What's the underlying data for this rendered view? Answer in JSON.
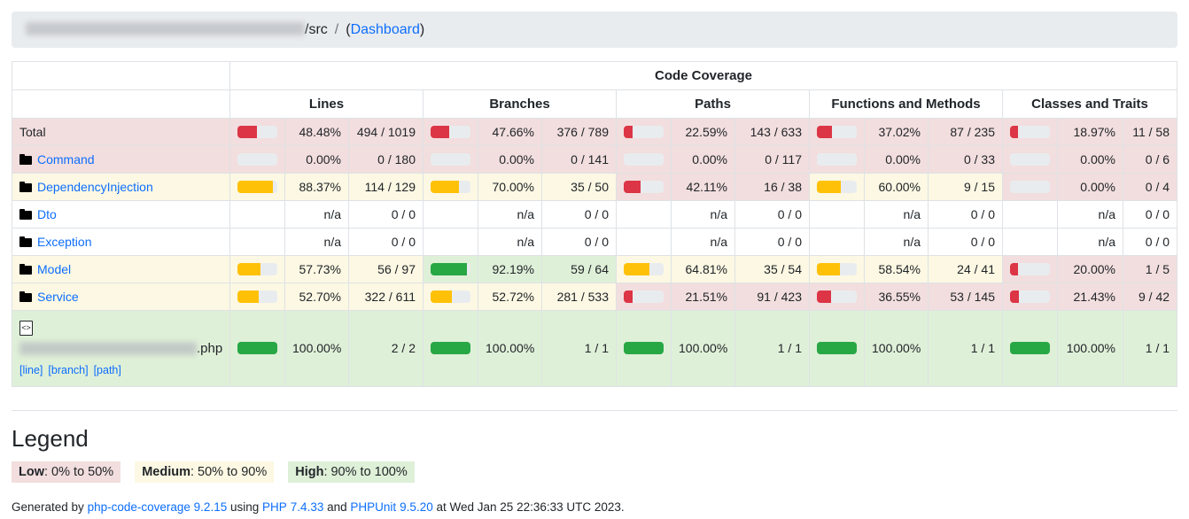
{
  "breadcrumb": {
    "redacted_path": "",
    "src_label": "/src",
    "separator": "/",
    "open_paren": "(",
    "dashboard_label": "Dashboard",
    "close_paren": ")"
  },
  "table": {
    "group_header": "Code Coverage",
    "metric_groups": [
      "Lines",
      "Branches",
      "Paths",
      "Functions and Methods",
      "Classes and Traits"
    ],
    "na_label": "n/a",
    "rows": [
      {
        "name": "Total",
        "kind": "total",
        "metrics": [
          {
            "percent": "48.48%",
            "fraction": "494 / 1019",
            "value": 48.48,
            "level": "low"
          },
          {
            "percent": "47.66%",
            "fraction": "376 / 789",
            "value": 47.66,
            "level": "low"
          },
          {
            "percent": "22.59%",
            "fraction": "143 / 633",
            "value": 22.59,
            "level": "low"
          },
          {
            "percent": "37.02%",
            "fraction": "87 / 235",
            "value": 37.02,
            "level": "low"
          },
          {
            "percent": "18.97%",
            "fraction": "11 / 58",
            "value": 18.97,
            "level": "low"
          }
        ]
      },
      {
        "name": "Command",
        "kind": "directory",
        "metrics": [
          {
            "percent": "0.00%",
            "fraction": "0 / 180",
            "value": 0,
            "level": "low"
          },
          {
            "percent": "0.00%",
            "fraction": "0 / 141",
            "value": 0,
            "level": "low"
          },
          {
            "percent": "0.00%",
            "fraction": "0 / 117",
            "value": 0,
            "level": "low"
          },
          {
            "percent": "0.00%",
            "fraction": "0 / 33",
            "value": 0,
            "level": "low"
          },
          {
            "percent": "0.00%",
            "fraction": "0 / 6",
            "value": 0,
            "level": "low"
          }
        ]
      },
      {
        "name": "DependencyInjection",
        "kind": "directory",
        "metrics": [
          {
            "percent": "88.37%",
            "fraction": "114 / 129",
            "value": 88.37,
            "level": "medium"
          },
          {
            "percent": "70.00%",
            "fraction": "35 / 50",
            "value": 70.0,
            "level": "medium"
          },
          {
            "percent": "42.11%",
            "fraction": "16 / 38",
            "value": 42.11,
            "level": "low"
          },
          {
            "percent": "60.00%",
            "fraction": "9 / 15",
            "value": 60.0,
            "level": "medium"
          },
          {
            "percent": "0.00%",
            "fraction": "0 / 4",
            "value": 0,
            "level": "low"
          }
        ]
      },
      {
        "name": "Dto",
        "kind": "directory",
        "metrics": [
          {
            "percent": "n/a",
            "fraction": "0 / 0",
            "value": null,
            "level": "none"
          },
          {
            "percent": "n/a",
            "fraction": "0 / 0",
            "value": null,
            "level": "none"
          },
          {
            "percent": "n/a",
            "fraction": "0 / 0",
            "value": null,
            "level": "none"
          },
          {
            "percent": "n/a",
            "fraction": "0 / 0",
            "value": null,
            "level": "none"
          },
          {
            "percent": "n/a",
            "fraction": "0 / 0",
            "value": null,
            "level": "none"
          }
        ]
      },
      {
        "name": "Exception",
        "kind": "directory",
        "metrics": [
          {
            "percent": "n/a",
            "fraction": "0 / 0",
            "value": null,
            "level": "none"
          },
          {
            "percent": "n/a",
            "fraction": "0 / 0",
            "value": null,
            "level": "none"
          },
          {
            "percent": "n/a",
            "fraction": "0 / 0",
            "value": null,
            "level": "none"
          },
          {
            "percent": "n/a",
            "fraction": "0 / 0",
            "value": null,
            "level": "none"
          },
          {
            "percent": "n/a",
            "fraction": "0 / 0",
            "value": null,
            "level": "none"
          }
        ]
      },
      {
        "name": "Model",
        "kind": "directory",
        "metrics": [
          {
            "percent": "57.73%",
            "fraction": "56 / 97",
            "value": 57.73,
            "level": "medium"
          },
          {
            "percent": "92.19%",
            "fraction": "59 / 64",
            "value": 92.19,
            "level": "high"
          },
          {
            "percent": "64.81%",
            "fraction": "35 / 54",
            "value": 64.81,
            "level": "medium"
          },
          {
            "percent": "58.54%",
            "fraction": "24 / 41",
            "value": 58.54,
            "level": "medium"
          },
          {
            "percent": "20.00%",
            "fraction": "1 / 5",
            "value": 20.0,
            "level": "low"
          }
        ]
      },
      {
        "name": "Service",
        "kind": "directory",
        "metrics": [
          {
            "percent": "52.70%",
            "fraction": "322 / 611",
            "value": 52.7,
            "level": "medium"
          },
          {
            "percent": "52.72%",
            "fraction": "281 / 533",
            "value": 52.72,
            "level": "medium"
          },
          {
            "percent": "21.51%",
            "fraction": "91 / 423",
            "value": 21.51,
            "level": "low"
          },
          {
            "percent": "36.55%",
            "fraction": "53 / 145",
            "value": 36.55,
            "level": "low"
          },
          {
            "percent": "21.43%",
            "fraction": "9 / 42",
            "value": 21.43,
            "level": "low"
          }
        ]
      },
      {
        "name": ".php",
        "kind": "file",
        "file_icon": "code-file-icon",
        "file_suffix": ".php",
        "sub_links": [
          "[line]",
          "[branch]",
          "[path]"
        ],
        "metrics": [
          {
            "percent": "100.00%",
            "fraction": "2 / 2",
            "value": 100,
            "level": "high"
          },
          {
            "percent": "100.00%",
            "fraction": "1 / 1",
            "value": 100,
            "level": "high"
          },
          {
            "percent": "100.00%",
            "fraction": "1 / 1",
            "value": 100,
            "level": "high"
          },
          {
            "percent": "100.00%",
            "fraction": "1 / 1",
            "value": 100,
            "level": "high"
          },
          {
            "percent": "100.00%",
            "fraction": "1 / 1",
            "value": 100,
            "level": "high"
          }
        ]
      }
    ]
  },
  "legend": {
    "title": "Legend",
    "items": [
      {
        "name": "Low",
        "range": ": 0% to 50%",
        "level": "low"
      },
      {
        "name": "Medium",
        "range": ": 50% to 90%",
        "level": "medium"
      },
      {
        "name": "High",
        "range": ": 90% to 100%",
        "level": "high"
      }
    ]
  },
  "footer": {
    "generated_by": "Generated by",
    "tool_name": "php-code-coverage",
    "tool_version": "9.2.15",
    "using": "using",
    "php_name": "PHP",
    "php_version": "7.4.33",
    "and": "and",
    "phpunit_name": "PHPUnit",
    "phpunit_version": "9.5.20",
    "at": "at",
    "timestamp": "Wed Jan 25 22:36:33 UTC 2023."
  },
  "colors": {
    "low": "#dc3545",
    "medium": "#ffc107",
    "high": "#28a745",
    "track": "#e9ecef",
    "link": "#0d6efd",
    "row_low": "#f2dede",
    "row_medium": "#fcf8e3",
    "row_high": "#dff0d8"
  }
}
